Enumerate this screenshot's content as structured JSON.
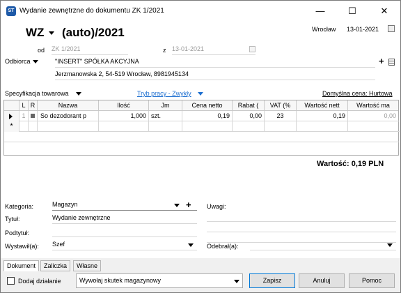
{
  "window": {
    "title": "Wydanie zewnętrzne do dokumentu ZK 1/2021",
    "icon_text": "ST"
  },
  "header": {
    "doc_type": "WZ",
    "doc_number": "(auto)/2021",
    "city": "Wrocław",
    "date": "13-01-2021",
    "od_label": "od",
    "od_value": "ZK 1/2021",
    "z_label": "z",
    "z_value": "13-01-2021"
  },
  "recipient": {
    "label": "Odbiorca",
    "name": "\"INSERT\" SPÓŁKA AKCYJNA",
    "address": "Jerzmanowska 2, 54-519 Wrocław, 8981945134"
  },
  "spec": {
    "label": "Specyfikacja towarowa",
    "mode": "Tryb pracy - Zwykły",
    "default_price": "Domyślna cena: Hurtowa"
  },
  "grid": {
    "columns": [
      "L",
      "R",
      "Nazwa",
      "Ilość",
      "Jm",
      "Cena netto",
      "Rabat (",
      "VAT (%",
      "Wartość nett",
      "Wartość ma"
    ],
    "rows": [
      {
        "lp": "1",
        "name": "So dezodorant p",
        "qty": "1,000",
        "unit": "szt.",
        "price": "0,19",
        "discount": "0,00",
        "vat": "23",
        "net": "0,19",
        "gross": "0,00"
      }
    ],
    "new_row_marker": "*"
  },
  "total": {
    "text": "Wartość: 0,19 PLN"
  },
  "form": {
    "kategoria_label": "Kategoria:",
    "kategoria_value": "Magazyn",
    "uwagi_label": "Uwagi:",
    "tytul_label": "Tytuł:",
    "tytul_value": "Wydanie zewnętrzne",
    "podtytul_label": "Podtytuł:",
    "wystawil_label": "Wystawił(a):",
    "wystawil_value": "Szef",
    "odebral_label": "Odebrał(a):"
  },
  "tabs": [
    "Dokument",
    "Zaliczka",
    "Własne"
  ],
  "footer": {
    "checkbox_label": "Dodaj działanie",
    "action_select": "Wywołaj skutek magazynowy",
    "save": "Zapisz",
    "cancel": "Anuluj",
    "help": "Pomoc"
  }
}
